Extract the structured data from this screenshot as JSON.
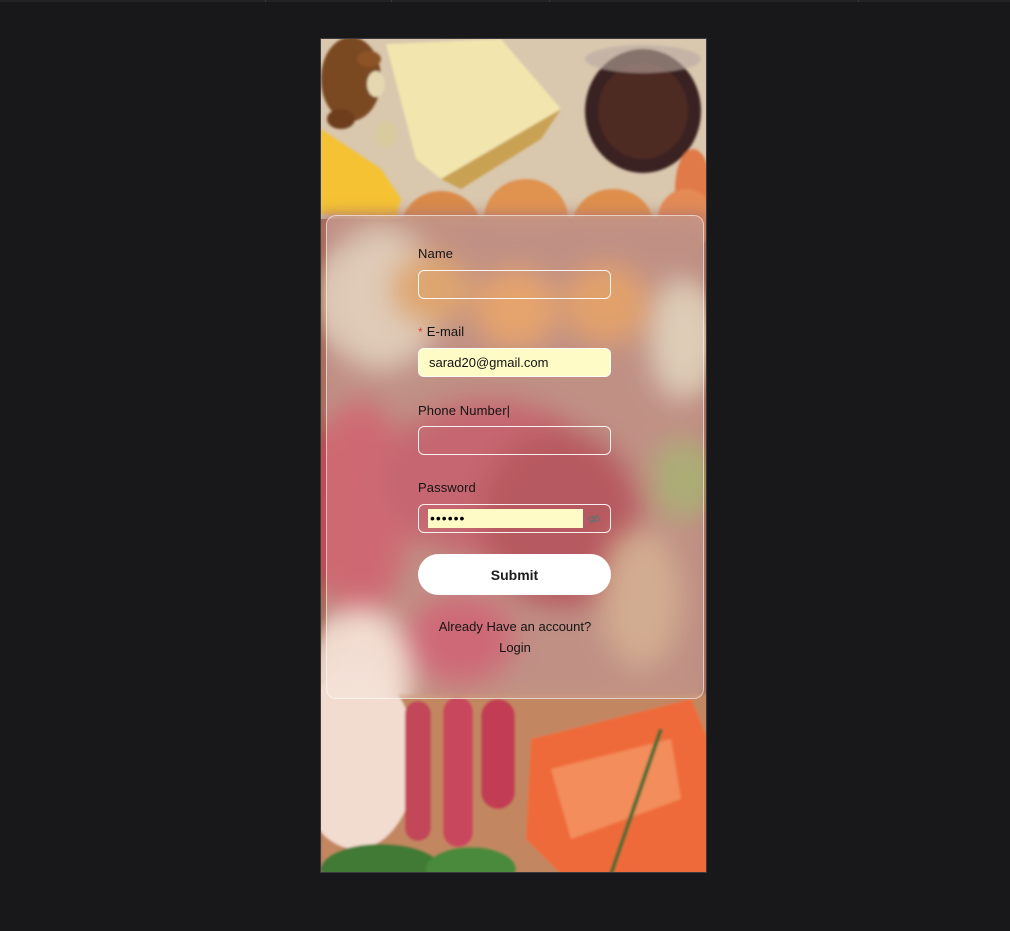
{
  "form": {
    "name_label": "Name",
    "name_value": "",
    "email_required_mark": "*",
    "email_label": "E-mail",
    "email_value": "sarad20@gmail.com",
    "phone_label": "Phone Number|",
    "phone_value": "",
    "password_label": "Password",
    "password_value": "••••••",
    "submit_label": "Submit"
  },
  "footer": {
    "prompt": "Already Have an account?",
    "login_label": "Login"
  },
  "icons": {
    "password_toggle": "eye-slash-icon"
  },
  "colors": {
    "autofill_bg": "#fefbc7",
    "required": "#e23c3c",
    "page_bg": "#18181b"
  }
}
